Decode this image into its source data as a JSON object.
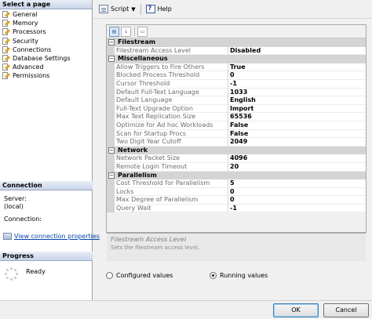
{
  "left_panel": {
    "select_page_header": "Select a page",
    "pages": [
      {
        "label": "General"
      },
      {
        "label": "Memory"
      },
      {
        "label": "Processors"
      },
      {
        "label": "Security"
      },
      {
        "label": "Connections"
      },
      {
        "label": "Database Settings"
      },
      {
        "label": "Advanced"
      },
      {
        "label": "Permissions"
      }
    ],
    "connection_header": "Connection",
    "server_label": "Server:",
    "server_value": "(local)",
    "connection_label": "Connection:",
    "view_connection_link": "View connection properties",
    "progress_header": "Progress",
    "progress_status": "Ready"
  },
  "toolbar": {
    "script_label": "Script",
    "help_label": "Help"
  },
  "grid": {
    "categories": [
      {
        "name": "Filestream",
        "rows": [
          {
            "name": "Filestream Access Level",
            "value": "Disabled"
          }
        ]
      },
      {
        "name": "Miscellaneous",
        "rows": [
          {
            "name": "Allow Triggers to Fire Others",
            "value": "True"
          },
          {
            "name": "Blocked Process Threshold",
            "value": "0"
          },
          {
            "name": "Cursor Threshold",
            "value": "-1"
          },
          {
            "name": "Default Full-Text Language",
            "value": "1033"
          },
          {
            "name": "Default Language",
            "value": "English"
          },
          {
            "name": "Full-Text Upgrade Option",
            "value": "Import"
          },
          {
            "name": "Max Text Replication Size",
            "value": "65536"
          },
          {
            "name": "Optimize for Ad hoc Workloads",
            "value": "False"
          },
          {
            "name": "Scan for Startup Procs",
            "value": "False"
          },
          {
            "name": "Two Digit Year Cutoff",
            "value": "2049"
          }
        ]
      },
      {
        "name": "Network",
        "rows": [
          {
            "name": "Network Packet Size",
            "value": "4096"
          },
          {
            "name": "Remote Login Timeout",
            "value": "20"
          }
        ]
      },
      {
        "name": "Parallelism",
        "rows": [
          {
            "name": "Cost Threshold for Parallelism",
            "value": "5"
          },
          {
            "name": "Locks",
            "value": "0"
          },
          {
            "name": "Max Degree of Parallelism",
            "value": "0"
          },
          {
            "name": "Query Wait",
            "value": "-1"
          }
        ]
      }
    ]
  },
  "description": {
    "title": "Filestream Access Level",
    "text": "Sets the filestream access level."
  },
  "radios": {
    "configured_label": "Configured values",
    "running_label": "Running values",
    "selected": "running"
  },
  "buttons": {
    "ok_label": "OK",
    "cancel_label": "Cancel"
  }
}
